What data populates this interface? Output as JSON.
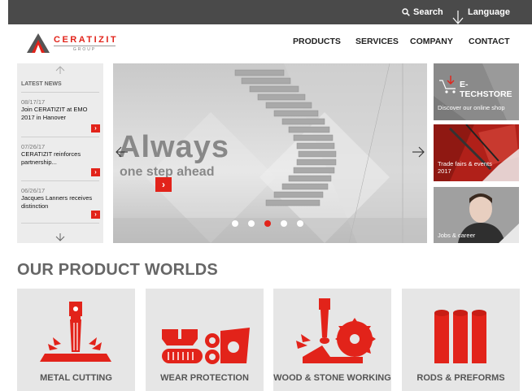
{
  "topbar": {
    "search_label": "Search",
    "language_label": "Language"
  },
  "logo": {
    "name": "CERATIZIT",
    "group": "GROUP"
  },
  "nav": {
    "items": [
      "PRODUCTS",
      "SERVICES",
      "COMPANY",
      "CONTACT"
    ]
  },
  "news": {
    "heading": "LATEST NEWS",
    "items": [
      {
        "date": "08/17/17",
        "text": "Join CERATIZIT at EMO 2017 in Hanover",
        "more": "›"
      },
      {
        "date": "07/26/17",
        "text": "CERATIZIT reinforces partnership...",
        "more": "›"
      },
      {
        "date": "06/26/17",
        "text": "Jacques Lanners receives distinction",
        "more": "›"
      }
    ]
  },
  "slider": {
    "headline": "Always",
    "subline": "one step ahead",
    "button": "›",
    "active_slide": 3,
    "slide_count": 5
  },
  "tiles": {
    "etechstore": {
      "title": "E-TECHSTORE",
      "label": "Discover our online shop"
    },
    "tradefairs": {
      "label": "Trade fairs & events 2017"
    },
    "jobs": {
      "label": "Jobs & career"
    }
  },
  "products": {
    "title": "OUR PRODUCT WORLDS",
    "items": [
      {
        "label": "METAL CUTTING",
        "icon": "metal-cutting-icon"
      },
      {
        "label": "WEAR PROTECTION",
        "icon": "wear-protection-icon"
      },
      {
        "label": "WOOD & STONE WORKING",
        "icon": "wood-stone-icon"
      },
      {
        "label": "RODS & PREFORMS",
        "icon": "rods-preforms-icon"
      }
    ]
  },
  "colors": {
    "brand_red": "#e2231a",
    "topbar": "#4a4a4a",
    "panel_gray": "#ececec",
    "card_gray": "#e6e6e6"
  }
}
